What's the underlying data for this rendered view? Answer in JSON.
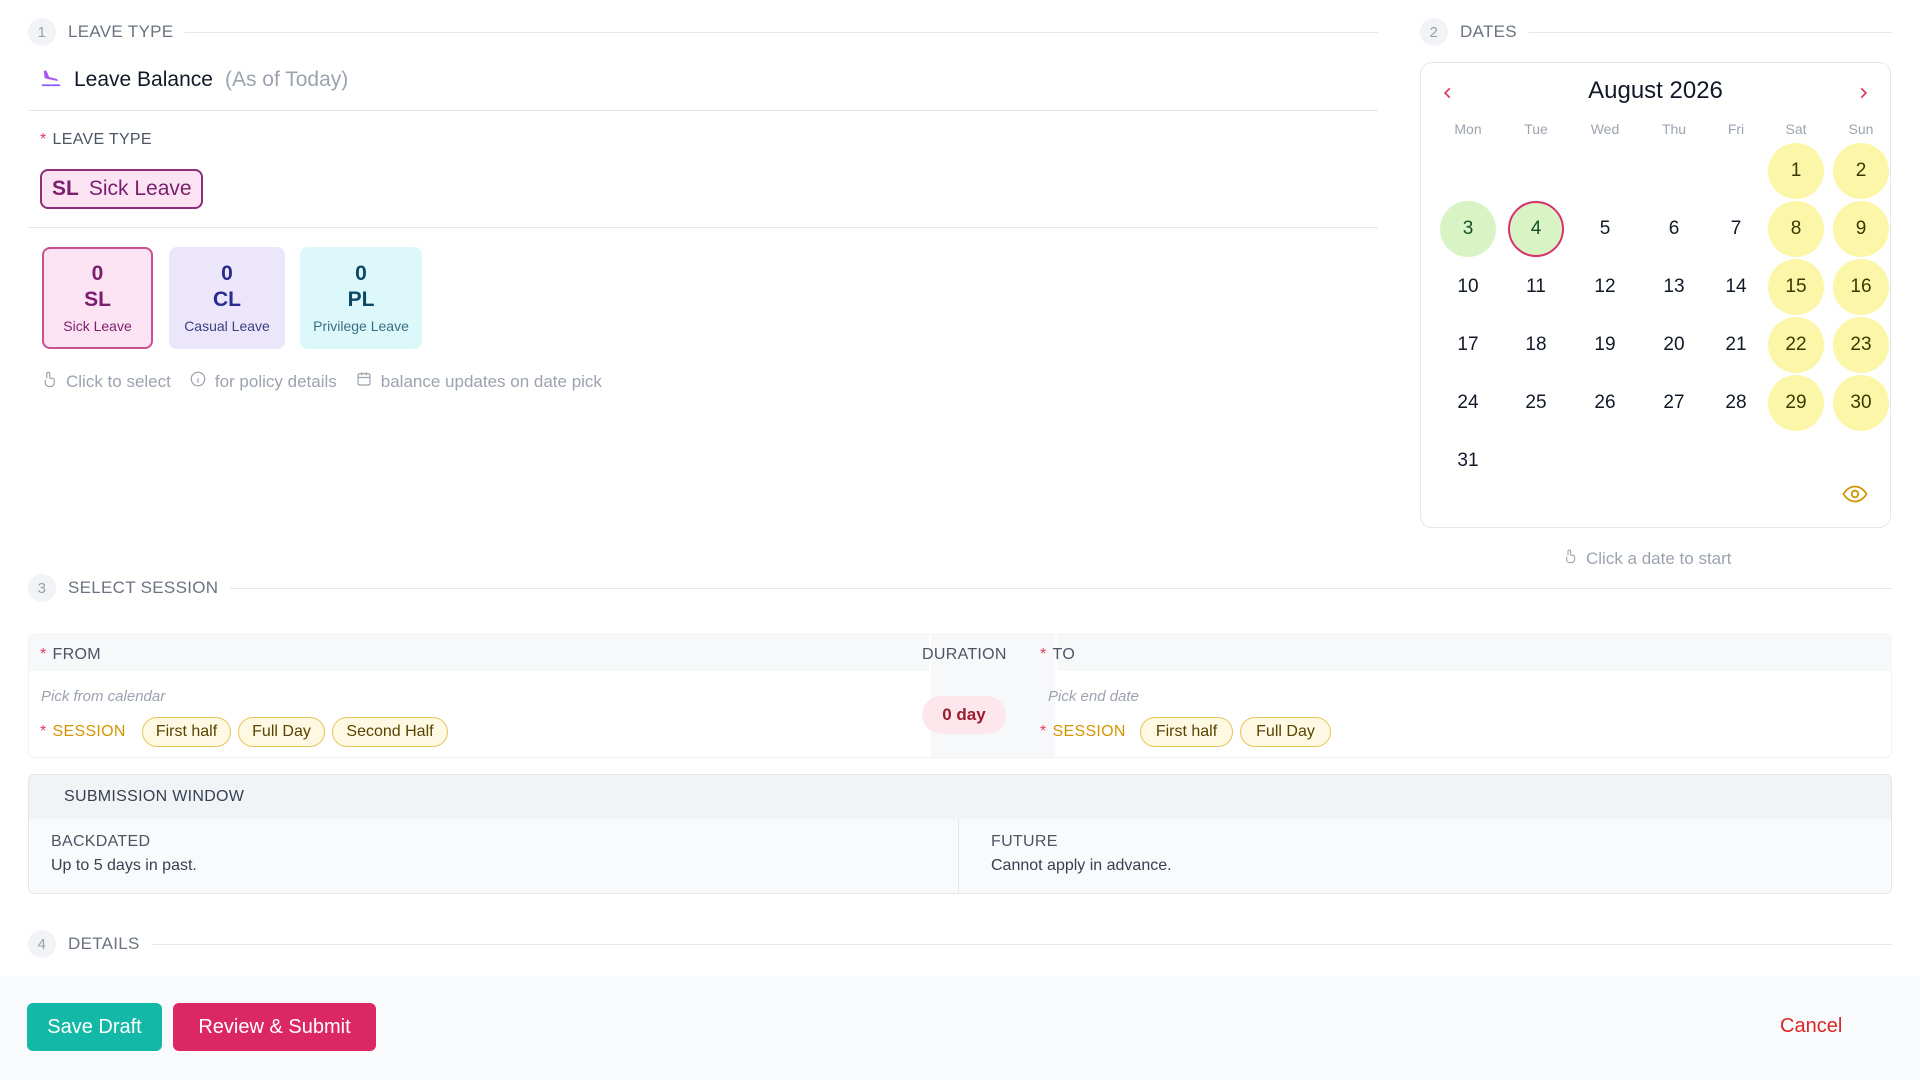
{
  "steps": {
    "leave_type": {
      "num": "1",
      "label": "LEAVE TYPE"
    },
    "dates": {
      "num": "2",
      "label": "DATES"
    },
    "session": {
      "num": "3",
      "label": "SELECT SESSION"
    },
    "details": {
      "num": "4",
      "label": "DETAILS"
    }
  },
  "balance": {
    "title": "Leave Balance",
    "subtitle": "(As of Today)"
  },
  "leave_type": {
    "label": "LEAVE TYPE",
    "required_mark": "*",
    "selected": {
      "code": "SL",
      "name": "Sick Leave"
    }
  },
  "cards": [
    {
      "count": "0",
      "code": "SL",
      "name": "Sick Leave"
    },
    {
      "count": "0",
      "code": "CL",
      "name": "Casual Leave"
    },
    {
      "count": "0",
      "code": "PL",
      "name": "Privilege Leave"
    }
  ],
  "hints": {
    "click": "Click to select",
    "policy": "for policy details",
    "balance": "balance updates on date pick"
  },
  "calendar": {
    "month_label": "August 2026",
    "weekdays": [
      "Mon",
      "Tue",
      "Wed",
      "Thu",
      "Fri",
      "Sat",
      "Sun"
    ],
    "days": [
      "1",
      "2",
      "3",
      "4",
      "5",
      "6",
      "7",
      "8",
      "9",
      "10",
      "11",
      "12",
      "13",
      "14",
      "15",
      "16",
      "17",
      "18",
      "19",
      "20",
      "21",
      "22",
      "23",
      "24",
      "25",
      "26",
      "27",
      "28",
      "29",
      "30",
      "31"
    ],
    "past_days": [
      "3"
    ],
    "today": "4",
    "weekend_days": [
      "1",
      "2",
      "8",
      "9",
      "15",
      "16",
      "22",
      "23",
      "29",
      "30"
    ],
    "hint": "Click a date to start",
    "colors": {
      "weekend": "#fbf6a8",
      "past": "#d9f4c4",
      "today_border": "#d6336c"
    }
  },
  "session": {
    "from_label": "FROM",
    "to_label": "TO",
    "duration_label": "DURATION",
    "duration_value": "0 day",
    "from_placeholder": "Pick from calendar",
    "to_placeholder": "Pick end date",
    "session_label": "SESSION",
    "from_options": [
      "First half",
      "Full Day",
      "Second Half"
    ],
    "to_options": [
      "First half",
      "Full Day"
    ]
  },
  "submission": {
    "title": "SUBMISSION WINDOW",
    "backdated": {
      "title": "BACKDATED",
      "text": "Up to 5 days in past."
    },
    "future": {
      "title": "FUTURE",
      "text": "Cannot apply in advance."
    }
  },
  "footer": {
    "save_draft": "Save Draft",
    "review_submit": "Review & Submit",
    "cancel": "Cancel"
  },
  "colors": {
    "primary": "#db2763",
    "teal": "#14b8a6",
    "cancel": "#dc2626"
  }
}
